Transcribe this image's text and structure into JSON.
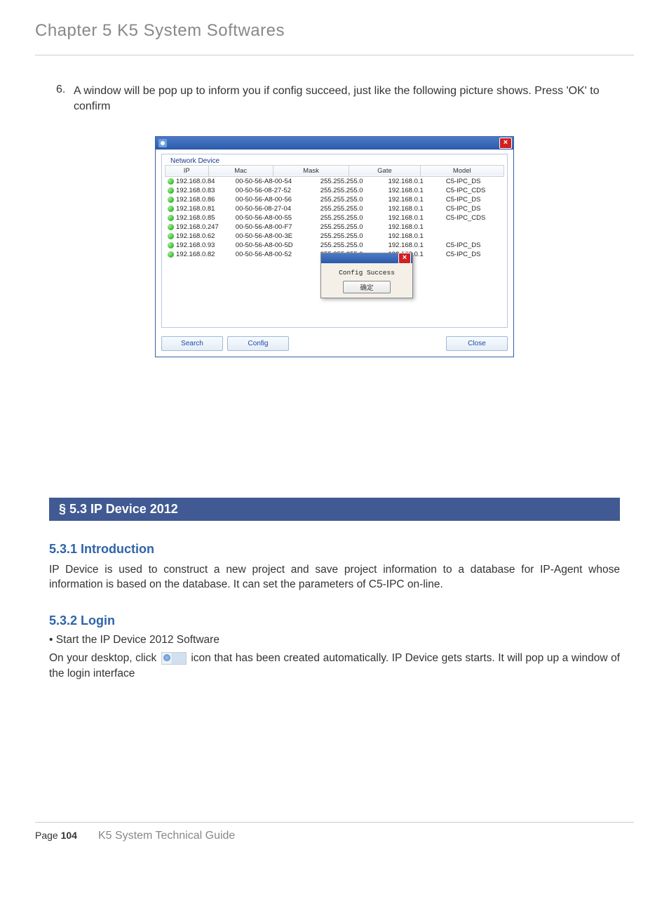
{
  "chapter_header": "Chapter 5    K5 System Softwares",
  "step": {
    "number": "6.",
    "text": "A window will be pop up to inform you if config succeed, just like the following picture shows. Press 'OK' to confirm"
  },
  "window": {
    "fieldset_label": "Network Device",
    "columns": {
      "ip": "IP",
      "mac": "Mac",
      "mask": "Mask",
      "gate": "Gate",
      "model": "Model"
    },
    "rows": [
      {
        "ip": "192.168.0.84",
        "mac": "00-50-56-A8-00-54",
        "mask": "255.255.255.0",
        "gate": "192.168.0.1",
        "model": "C5-IPC_DS"
      },
      {
        "ip": "192.168.0.83",
        "mac": "00-50-56-08-27-52",
        "mask": "255.255.255.0",
        "gate": "192.168.0.1",
        "model": "C5-IPC_CDS"
      },
      {
        "ip": "192.168.0.86",
        "mac": "00-50-56-A8-00-56",
        "mask": "255.255.255.0",
        "gate": "192.168.0.1",
        "model": "C5-IPC_DS"
      },
      {
        "ip": "192.168.0.81",
        "mac": "00-50-56-08-27-04",
        "mask": "255.255.255.0",
        "gate": "192.168.0.1",
        "model": "C5-IPC_DS"
      },
      {
        "ip": "192.168.0.85",
        "mac": "00-50-56-A8-00-55",
        "mask": "255.255.255.0",
        "gate": "192.168.0.1",
        "model": "C5-IPC_CDS"
      },
      {
        "ip": "192.168.0.247",
        "mac": "00-50-56-A8-00-F7",
        "mask": "255.255.255.0",
        "gate": "192.168.0.1",
        "model": ""
      },
      {
        "ip": "192.168.0.62",
        "mac": "00-50-56-A8-00-3E",
        "mask": "255.255.255.0",
        "gate": "192.168.0.1",
        "model": ""
      },
      {
        "ip": "192.168.0.93",
        "mac": "00-50-56-A8-00-5D",
        "mask": "255.255.255.0",
        "gate": "192.168.0.1",
        "model": "C5-IPC_DS"
      },
      {
        "ip": "192.168.0.82",
        "mac": "00-50-56-A8-00-52",
        "mask": "255.255.255.0",
        "gate": "192.168.0.1",
        "model": "C5-IPC_DS"
      }
    ],
    "buttons": {
      "search": "Search",
      "config": "Config",
      "close": "Close"
    },
    "popup": {
      "message": "Config Success",
      "ok": "确定"
    }
  },
  "section_bar": "§ 5.3 IP Device 2012",
  "sub531": {
    "title": "5.3.1 Introduction",
    "body": "IP Device is used to construct a new project and save project information to a database for IP-Agent whose information is based on the database. It can set the parameters of C5-IPC on-line."
  },
  "sub532": {
    "title": "5.3.2 Login",
    "bullet": "Start the IP Device 2012 Software",
    "body_pre": "On your desktop, click ",
    "body_post": " icon that has been created automatically. IP Device gets starts. It will pop up a window of the login interface"
  },
  "footer": {
    "page_label": "Page",
    "page_number": "104",
    "guide": "K5 System Technical Guide"
  }
}
